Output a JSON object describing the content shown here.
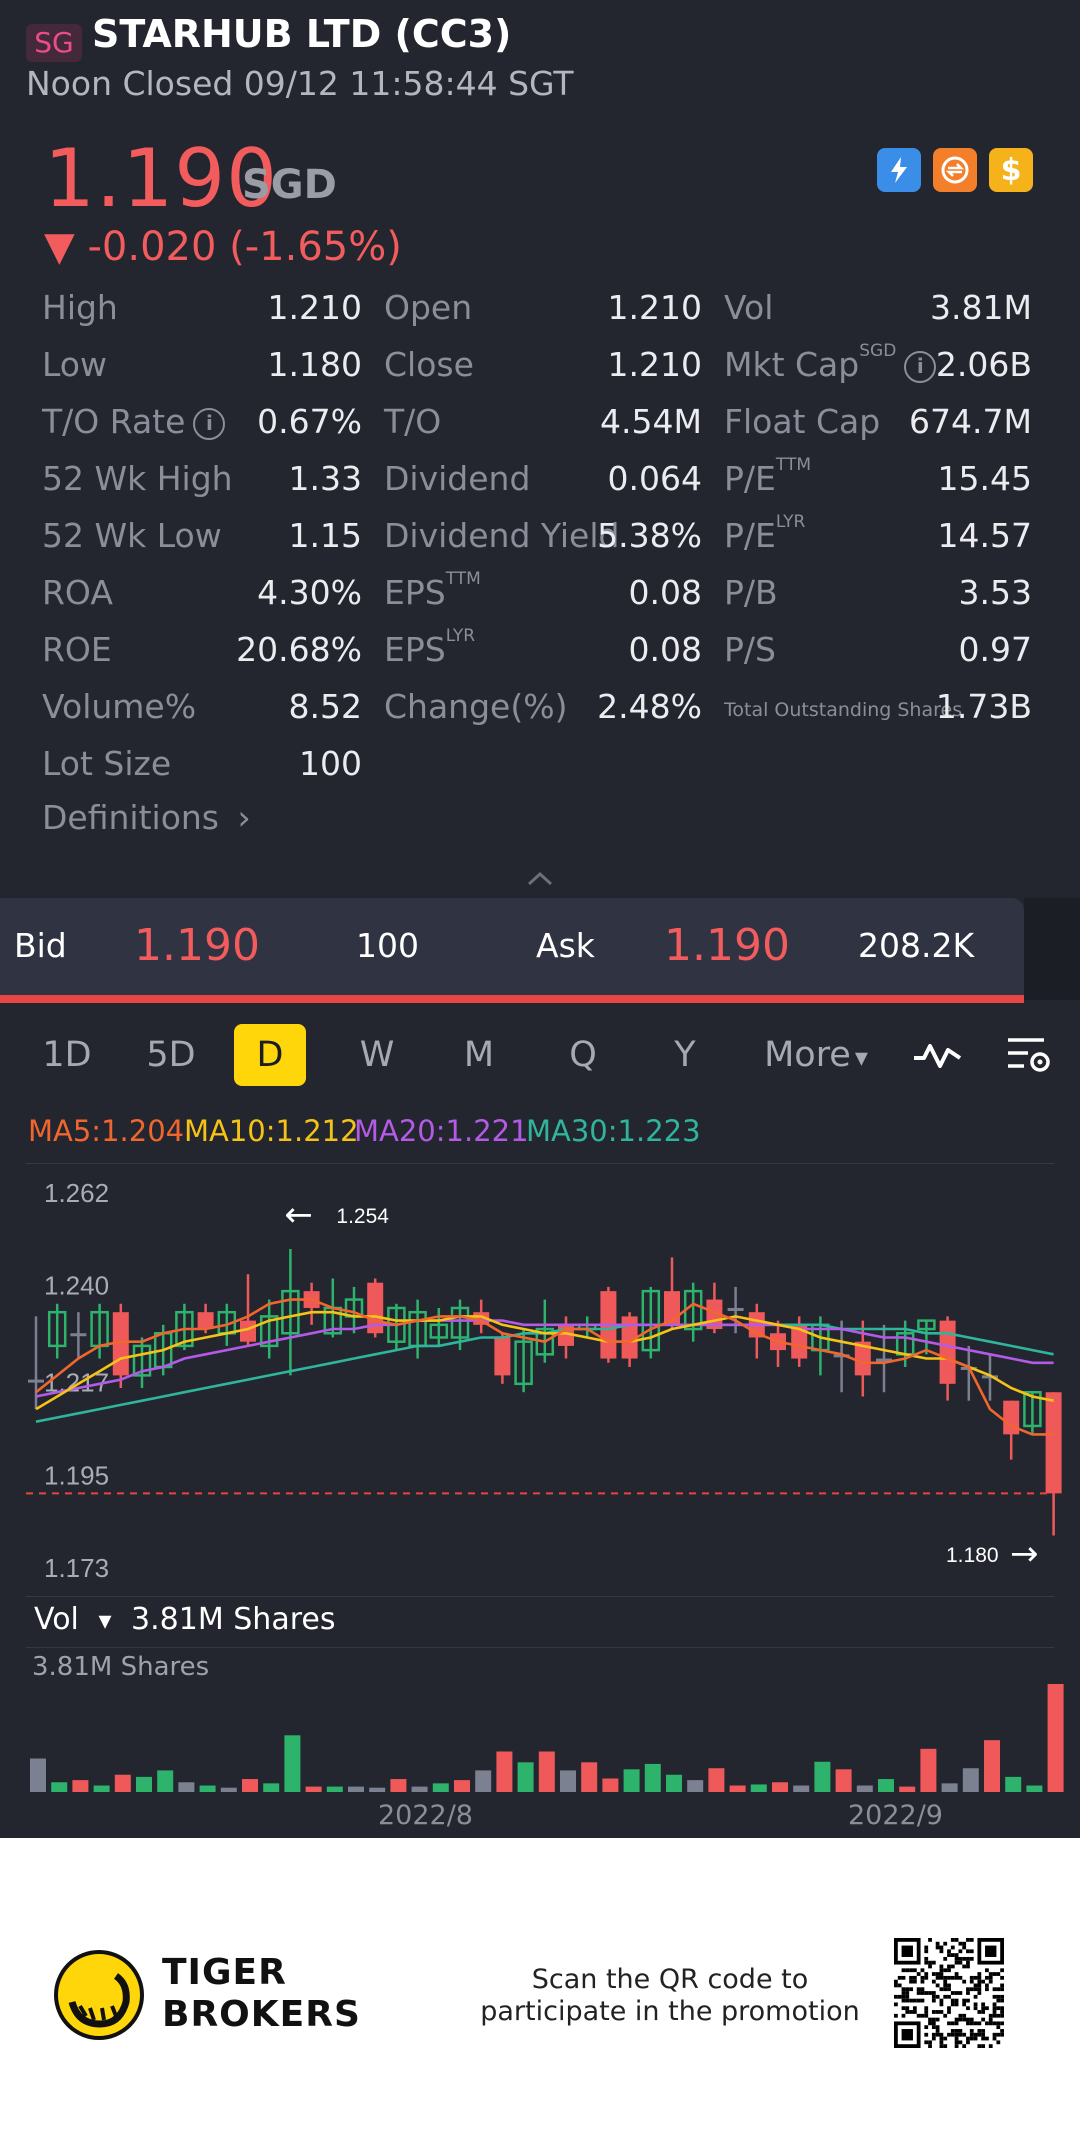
{
  "header": {
    "market": "SG",
    "title": "STARHUB LTD (CC3)",
    "status": "Noon Closed 09/12 11:58:44 SGT"
  },
  "quote": {
    "price": "1.190",
    "currency": "SGD",
    "change": "▼ -0.020 (-1.65%)",
    "icons": [
      "lightning-badge-icon",
      "exchange-badge-icon",
      "dollar-badge-icon"
    ],
    "dollar_glyph": "$"
  },
  "stats": {
    "col1": [
      {
        "label": "High",
        "value": "1.210"
      },
      {
        "label": "Low",
        "value": "1.180"
      },
      {
        "label": "T/O Rate",
        "value": "0.67%",
        "info": true
      },
      {
        "label": "52 Wk High",
        "value": "1.33"
      },
      {
        "label": "52 Wk Low",
        "value": "1.15"
      },
      {
        "label": "ROA",
        "value": "4.30%"
      },
      {
        "label": "ROE",
        "value": "20.68%"
      },
      {
        "label": "Volume%",
        "value": "8.52"
      },
      {
        "label": "Lot Size",
        "value": "100"
      }
    ],
    "col2": [
      {
        "label": "Open",
        "value": "1.210"
      },
      {
        "label": "Close",
        "value": "1.210"
      },
      {
        "label": "T/O",
        "value": "4.54M"
      },
      {
        "label": "Dividend",
        "value": "0.064"
      },
      {
        "label": "Dividend Yield",
        "value": "5.38%"
      },
      {
        "label": "EPS",
        "sup": "TTM",
        "value": "0.08"
      },
      {
        "label": "EPS",
        "sup": "LYR",
        "value": "0.08"
      },
      {
        "label": "Change(%)",
        "value": "2.48%"
      }
    ],
    "col3": [
      {
        "label": "Vol",
        "value": "3.81M"
      },
      {
        "label": "Mkt Cap",
        "sup": "SGD",
        "value": "2.06B",
        "info": true
      },
      {
        "label": "Float Cap",
        "value": "674.7M"
      },
      {
        "label": "P/E",
        "sup": "TTM",
        "value": "15.45"
      },
      {
        "label": "P/E",
        "sup": "LYR",
        "value": "14.57"
      },
      {
        "label": "P/B",
        "value": "3.53"
      },
      {
        "label": "P/S",
        "value": "0.97"
      },
      {
        "label": "Total Outstanding Shares",
        "value": "1.73B",
        "small": true
      }
    ],
    "info_glyph": "i",
    "definitions": "Definitions",
    "definitions_chevron": "›"
  },
  "bidask": {
    "bid_label": "Bid",
    "bid_price": "1.190",
    "bid_size": "100",
    "ask_label": "Ask",
    "ask_price": "1.190",
    "ask_size": "208.2K"
  },
  "tabs": [
    "1D",
    "5D",
    "D",
    "W",
    "M",
    "Q",
    "Y"
  ],
  "active_tab": "D",
  "more_label": "More",
  "more_caret": "▾",
  "ma": [
    {
      "label": "MA5:1.204",
      "color": "#f0662f"
    },
    {
      "label": "MA10:1.212",
      "color": "#f5c315"
    },
    {
      "label": "MA20:1.221",
      "color": "#b35be6"
    },
    {
      "label": "MA30:1.223",
      "color": "#2fb59c"
    }
  ],
  "chart_data": {
    "type": "candlestick",
    "y_ticks": [
      "1.262",
      "1.240",
      "1.217",
      "1.195",
      "1.173"
    ],
    "ylim": [
      1.173,
      1.262
    ],
    "high_marker": {
      "value": "1.254",
      "arrow": "←"
    },
    "low_marker": {
      "value": "1.180",
      "arrow": "→"
    },
    "current_price_line": 1.19,
    "colors": {
      "up": "#2db36c",
      "down": "#f0595a",
      "flat": "#7c8192"
    },
    "candles": [
      {
        "o": 1.217,
        "c": 1.217,
        "h": 1.232,
        "l": 1.21
      },
      {
        "o": 1.225,
        "c": 1.233,
        "h": 1.235,
        "l": 1.222
      },
      {
        "o": 1.228,
        "c": 1.228,
        "h": 1.233,
        "l": 1.222
      },
      {
        "o": 1.225,
        "c": 1.233,
        "h": 1.235,
        "l": 1.222
      },
      {
        "o": 1.233,
        "c": 1.218,
        "h": 1.235,
        "l": 1.215
      },
      {
        "o": 1.218,
        "c": 1.225,
        "h": 1.227,
        "l": 1.215
      },
      {
        "o": 1.22,
        "c": 1.228,
        "h": 1.23,
        "l": 1.218
      },
      {
        "o": 1.225,
        "c": 1.233,
        "h": 1.235,
        "l": 1.224
      },
      {
        "o": 1.233,
        "c": 1.229,
        "h": 1.235,
        "l": 1.228
      },
      {
        "o": 1.228,
        "c": 1.233,
        "h": 1.235,
        "l": 1.225
      },
      {
        "o": 1.231,
        "c": 1.226,
        "h": 1.242,
        "l": 1.225
      },
      {
        "o": 1.225,
        "c": 1.232,
        "h": 1.236,
        "l": 1.222
      },
      {
        "o": 1.228,
        "c": 1.238,
        "h": 1.248,
        "l": 1.218
      },
      {
        "o": 1.238,
        "c": 1.234,
        "h": 1.24,
        "l": 1.23
      },
      {
        "o": 1.228,
        "c": 1.234,
        "h": 1.241,
        "l": 1.227
      },
      {
        "o": 1.232,
        "c": 1.236,
        "h": 1.239,
        "l": 1.228
      },
      {
        "o": 1.24,
        "c": 1.228,
        "h": 1.241,
        "l": 1.227
      },
      {
        "o": 1.226,
        "c": 1.234,
        "h": 1.235,
        "l": 1.224
      },
      {
        "o": 1.225,
        "c": 1.233,
        "h": 1.236,
        "l": 1.222
      },
      {
        "o": 1.227,
        "c": 1.23,
        "h": 1.234,
        "l": 1.225
      },
      {
        "o": 1.227,
        "c": 1.234,
        "h": 1.236,
        "l": 1.224
      },
      {
        "o": 1.233,
        "c": 1.23,
        "h": 1.236,
        "l": 1.228
      },
      {
        "o": 1.227,
        "c": 1.218,
        "h": 1.228,
        "l": 1.216
      },
      {
        "o": 1.216,
        "c": 1.226,
        "h": 1.229,
        "l": 1.214
      },
      {
        "o": 1.223,
        "c": 1.229,
        "h": 1.236,
        "l": 1.221
      },
      {
        "o": 1.23,
        "c": 1.225,
        "h": 1.232,
        "l": 1.222
      },
      {
        "o": 1.229,
        "c": 1.23,
        "h": 1.232,
        "l": 1.227
      },
      {
        "o": 1.238,
        "c": 1.222,
        "h": 1.239,
        "l": 1.221
      },
      {
        "o": 1.232,
        "c": 1.222,
        "h": 1.233,
        "l": 1.22
      },
      {
        "o": 1.224,
        "c": 1.238,
        "h": 1.239,
        "l": 1.222
      },
      {
        "o": 1.238,
        "c": 1.23,
        "h": 1.246,
        "l": 1.229
      },
      {
        "o": 1.229,
        "c": 1.238,
        "h": 1.24,
        "l": 1.226
      },
      {
        "o": 1.236,
        "c": 1.229,
        "h": 1.24,
        "l": 1.228
      },
      {
        "o": 1.234,
        "c": 1.234,
        "h": 1.239,
        "l": 1.228
      },
      {
        "o": 1.233,
        "c": 1.227,
        "h": 1.235,
        "l": 1.222
      },
      {
        "o": 1.228,
        "c": 1.224,
        "h": 1.231,
        "l": 1.22
      },
      {
        "o": 1.23,
        "c": 1.222,
        "h": 1.232,
        "l": 1.22
      },
      {
        "o": 1.224,
        "c": 1.23,
        "h": 1.232,
        "l": 1.218
      },
      {
        "o": 1.223,
        "c": 1.223,
        "h": 1.231,
        "l": 1.214
      },
      {
        "o": 1.226,
        "c": 1.218,
        "h": 1.231,
        "l": 1.213
      },
      {
        "o": 1.222,
        "c": 1.222,
        "h": 1.23,
        "l": 1.214
      },
      {
        "o": 1.223,
        "c": 1.228,
        "h": 1.231,
        "l": 1.22
      },
      {
        "o": 1.229,
        "c": 1.231,
        "h": 1.231,
        "l": 1.223
      },
      {
        "o": 1.231,
        "c": 1.216,
        "h": 1.232,
        "l": 1.212
      },
      {
        "o": 1.22,
        "c": 1.22,
        "h": 1.225,
        "l": 1.212
      },
      {
        "o": 1.218,
        "c": 1.218,
        "h": 1.223,
        "l": 1.212
      },
      {
        "o": 1.212,
        "c": 1.204,
        "h": 1.212,
        "l": 1.198
      },
      {
        "o": 1.206,
        "c": 1.214,
        "h": 1.214,
        "l": 1.204
      },
      {
        "o": 1.214,
        "c": 1.19,
        "h": 1.214,
        "l": 1.18
      }
    ],
    "ma5": [
      1.214,
      1.218,
      1.222,
      1.225,
      1.226,
      1.226,
      1.228,
      1.229,
      1.229,
      1.23,
      1.232,
      1.235,
      1.236,
      1.236,
      1.234,
      1.233,
      1.231,
      1.23,
      1.231,
      1.232,
      1.232,
      1.231,
      1.228,
      1.227,
      1.226,
      1.229,
      1.229,
      1.226,
      1.226,
      1.229,
      1.231,
      1.235,
      1.233,
      1.231,
      1.228,
      1.226,
      1.225,
      1.224,
      1.223,
      1.221,
      1.221,
      1.222,
      1.224,
      1.222,
      1.22,
      1.21,
      1.206,
      1.204,
      1.204
    ],
    "ma10": [
      1.21,
      1.213,
      1.216,
      1.219,
      1.222,
      1.223,
      1.224,
      1.226,
      1.227,
      1.228,
      1.229,
      1.231,
      1.232,
      1.233,
      1.233,
      1.232,
      1.232,
      1.231,
      1.231,
      1.231,
      1.232,
      1.232,
      1.23,
      1.229,
      1.228,
      1.228,
      1.227,
      1.226,
      1.226,
      1.227,
      1.229,
      1.23,
      1.231,
      1.232,
      1.231,
      1.23,
      1.229,
      1.227,
      1.226,
      1.225,
      1.224,
      1.223,
      1.222,
      1.222,
      1.22,
      1.218,
      1.215,
      1.213,
      1.212
    ],
    "ma20": [
      1.213,
      1.214,
      1.215,
      1.216,
      1.217,
      1.219,
      1.22,
      1.222,
      1.223,
      1.224,
      1.225,
      1.226,
      1.227,
      1.228,
      1.229,
      1.229,
      1.23,
      1.23,
      1.231,
      1.231,
      1.231,
      1.231,
      1.231,
      1.23,
      1.23,
      1.23,
      1.23,
      1.23,
      1.23,
      1.23,
      1.23,
      1.23,
      1.23,
      1.23,
      1.23,
      1.23,
      1.229,
      1.229,
      1.229,
      1.228,
      1.227,
      1.227,
      1.226,
      1.225,
      1.224,
      1.223,
      1.222,
      1.221,
      1.221
    ],
    "ma30": [
      1.207,
      1.208,
      1.209,
      1.21,
      1.211,
      1.212,
      1.213,
      1.214,
      1.215,
      1.216,
      1.217,
      1.218,
      1.219,
      1.22,
      1.221,
      1.222,
      1.223,
      1.224,
      1.225,
      1.225,
      1.226,
      1.227,
      1.227,
      1.228,
      1.228,
      1.229,
      1.229,
      1.229,
      1.23,
      1.23,
      1.23,
      1.23,
      1.23,
      1.23,
      1.23,
      1.23,
      1.23,
      1.23,
      1.229,
      1.229,
      1.229,
      1.229,
      1.228,
      1.228,
      1.227,
      1.226,
      1.225,
      1.224,
      1.223
    ]
  },
  "volume": {
    "header_label": "Vol",
    "header_caret": "▾",
    "header_value": "3.81M Shares",
    "max_label": "3.81M Shares",
    "date_labels": [
      "2022/8",
      "2022/9"
    ],
    "bars": [
      {
        "v": 0.62,
        "s": "flat"
      },
      {
        "v": 0.18,
        "s": "up"
      },
      {
        "v": 0.22,
        "s": "down"
      },
      {
        "v": 0.12,
        "s": "up"
      },
      {
        "v": 0.32,
        "s": "down"
      },
      {
        "v": 0.28,
        "s": "up"
      },
      {
        "v": 0.4,
        "s": "up"
      },
      {
        "v": 0.18,
        "s": "flat"
      },
      {
        "v": 0.12,
        "s": "up"
      },
      {
        "v": 0.08,
        "s": "flat"
      },
      {
        "v": 0.24,
        "s": "down"
      },
      {
        "v": 0.16,
        "s": "up"
      },
      {
        "v": 1.05,
        "s": "up"
      },
      {
        "v": 0.1,
        "s": "down"
      },
      {
        "v": 0.1,
        "s": "up"
      },
      {
        "v": 0.1,
        "s": "flat"
      },
      {
        "v": 0.08,
        "s": "flat"
      },
      {
        "v": 0.24,
        "s": "down"
      },
      {
        "v": 0.1,
        "s": "flat"
      },
      {
        "v": 0.16,
        "s": "up"
      },
      {
        "v": 0.22,
        "s": "down"
      },
      {
        "v": 0.4,
        "s": "flat"
      },
      {
        "v": 0.75,
        "s": "down"
      },
      {
        "v": 0.55,
        "s": "up"
      },
      {
        "v": 0.75,
        "s": "down"
      },
      {
        "v": 0.4,
        "s": "flat"
      },
      {
        "v": 0.55,
        "s": "down"
      },
      {
        "v": 0.25,
        "s": "down"
      },
      {
        "v": 0.42,
        "s": "up"
      },
      {
        "v": 0.52,
        "s": "up"
      },
      {
        "v": 0.32,
        "s": "up"
      },
      {
        "v": 0.22,
        "s": "flat"
      },
      {
        "v": 0.44,
        "s": "down"
      },
      {
        "v": 0.12,
        "s": "down"
      },
      {
        "v": 0.14,
        "s": "up"
      },
      {
        "v": 0.18,
        "s": "down"
      },
      {
        "v": 0.12,
        "s": "flat"
      },
      {
        "v": 0.56,
        "s": "up"
      },
      {
        "v": 0.42,
        "s": "down"
      },
      {
        "v": 0.12,
        "s": "flat"
      },
      {
        "v": 0.24,
        "s": "up"
      },
      {
        "v": 0.1,
        "s": "down"
      },
      {
        "v": 0.8,
        "s": "down"
      },
      {
        "v": 0.16,
        "s": "flat"
      },
      {
        "v": 0.44,
        "s": "flat"
      },
      {
        "v": 0.96,
        "s": "down"
      },
      {
        "v": 0.28,
        "s": "up"
      },
      {
        "v": 0.12,
        "s": "up"
      },
      {
        "v": 2.0,
        "s": "down"
      }
    ]
  },
  "footer": {
    "brand_line1": "TIGER",
    "brand_line2": "BROKERS",
    "promo_line1": "Scan the QR code to",
    "promo_line2": "participate in the promotion"
  }
}
